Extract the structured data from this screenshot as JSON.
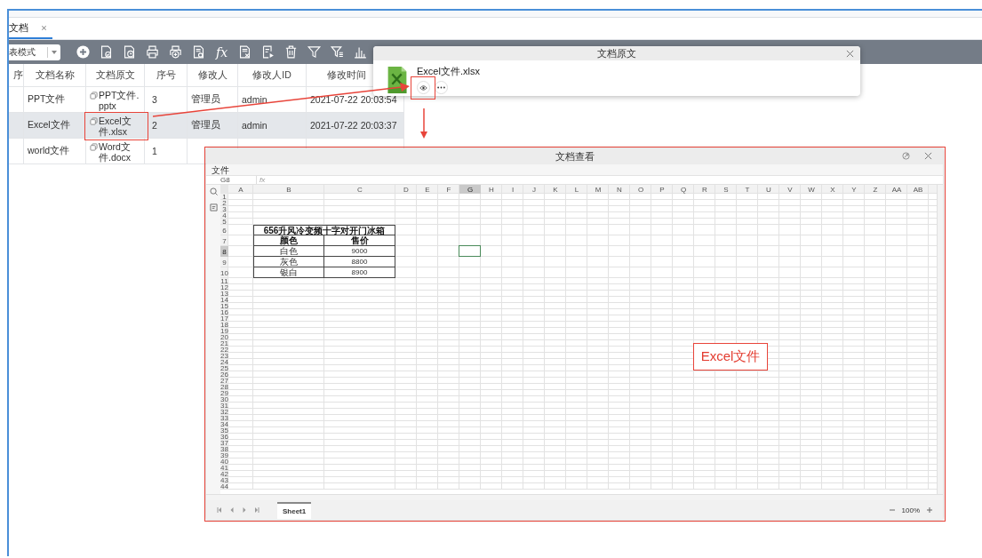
{
  "tabs": [
    {
      "label": "文档",
      "selected": true
    }
  ],
  "toolbar": {
    "view_mode": "表模式",
    "formula_label": "fx"
  },
  "table": {
    "columns": [
      "序",
      "文档名称",
      "文档原文",
      "序号",
      "修改人",
      "修改人ID",
      "修改时间"
    ],
    "rows": [
      {
        "name": "PPT文件",
        "file": "PPT文件.pptx",
        "seq": "3",
        "modifier": "管理员",
        "modifier_id": "admin",
        "modified": "2021-07-22 20:03:54",
        "selected": false
      },
      {
        "name": "Excel文件",
        "file": "Excel文件.xlsx",
        "seq": "2",
        "modifier": "管理员",
        "modifier_id": "admin",
        "modified": "2021-07-22 20:03:37",
        "selected": true
      },
      {
        "name": "world文件",
        "file": "Word文件.docx",
        "seq": "1",
        "selected": false
      }
    ]
  },
  "popup": {
    "title": "文档原文",
    "file_name": "Excel文件.xlsx"
  },
  "viewer": {
    "title": "文档查看",
    "menu": [
      "文件"
    ],
    "name_box": "G8",
    "formula_label": "fx",
    "columns": [
      {
        "label": "A",
        "selected": false
      },
      {
        "label": "B",
        "selected": false
      },
      {
        "label": "C",
        "selected": false
      },
      {
        "label": "D",
        "selected": false
      },
      {
        "label": "E",
        "selected": false
      },
      {
        "label": "F",
        "selected": false
      },
      {
        "label": "G",
        "selected": true
      },
      {
        "label": "H",
        "selected": false
      },
      {
        "label": "I",
        "selected": false
      },
      {
        "label": "J",
        "selected": false
      },
      {
        "label": "K",
        "selected": false
      },
      {
        "label": "L",
        "selected": false
      },
      {
        "label": "M",
        "selected": false
      },
      {
        "label": "N",
        "selected": false
      },
      {
        "label": "O",
        "selected": false
      },
      {
        "label": "P",
        "selected": false
      },
      {
        "label": "Q",
        "selected": false
      },
      {
        "label": "R",
        "selected": false
      },
      {
        "label": "S",
        "selected": false
      },
      {
        "label": "T",
        "selected": false
      },
      {
        "label": "U",
        "selected": false
      },
      {
        "label": "V",
        "selected": false
      },
      {
        "label": "W",
        "selected": false
      },
      {
        "label": "X",
        "selected": false
      },
      {
        "label": "Y",
        "selected": false
      },
      {
        "label": "Z",
        "selected": false
      },
      {
        "label": "AA",
        "selected": false
      },
      {
        "label": "AB",
        "selected": false
      }
    ],
    "rows": [
      {
        "label": "1",
        "selected": false
      },
      {
        "label": "2",
        "selected": false
      },
      {
        "label": "3",
        "selected": false
      },
      {
        "label": "4",
        "selected": false
      },
      {
        "label": "5",
        "selected": false
      },
      {
        "label": "6",
        "selected": false
      },
      {
        "label": "7",
        "selected": false
      },
      {
        "label": "8",
        "selected": true
      },
      {
        "label": "9",
        "selected": false
      },
      {
        "label": "10",
        "selected": false
      },
      {
        "label": "11",
        "selected": false
      },
      {
        "label": "12",
        "selected": false
      },
      {
        "label": "13",
        "selected": false
      },
      {
        "label": "14",
        "selected": false
      },
      {
        "label": "15",
        "selected": false
      },
      {
        "label": "16",
        "selected": false
      },
      {
        "label": "17",
        "selected": false
      },
      {
        "label": "18",
        "selected": false
      },
      {
        "label": "19",
        "selected": false
      },
      {
        "label": "20",
        "selected": false
      },
      {
        "label": "21",
        "selected": false
      },
      {
        "label": "22",
        "selected": false
      },
      {
        "label": "23",
        "selected": false
      },
      {
        "label": "24",
        "selected": false
      },
      {
        "label": "25",
        "selected": false
      },
      {
        "label": "26",
        "selected": false
      },
      {
        "label": "27",
        "selected": false
      },
      {
        "label": "28",
        "selected": false
      },
      {
        "label": "29",
        "selected": false
      },
      {
        "label": "30",
        "selected": false
      },
      {
        "label": "31",
        "selected": false
      },
      {
        "label": "32",
        "selected": false
      },
      {
        "label": "33",
        "selected": false
      },
      {
        "label": "34",
        "selected": false
      },
      {
        "label": "35",
        "selected": false
      },
      {
        "label": "36",
        "selected": false
      },
      {
        "label": "37",
        "selected": false
      },
      {
        "label": "38",
        "selected": false
      },
      {
        "label": "39",
        "selected": false
      },
      {
        "label": "40",
        "selected": false
      },
      {
        "label": "41",
        "selected": false
      },
      {
        "label": "42",
        "selected": false
      },
      {
        "label": "43",
        "selected": false
      },
      {
        "label": "44",
        "selected": false
      }
    ],
    "sheet_table": {
      "title": "656升风冷变频十字对开门冰箱",
      "header": [
        "颜色",
        "售价"
      ],
      "rows": [
        [
          "白色",
          "9000"
        ],
        [
          "灰色",
          "8800"
        ],
        [
          "银白",
          "8900"
        ]
      ]
    },
    "sheet_tabs": [
      {
        "label": "Sheet1",
        "selected": true
      }
    ],
    "zoom": "100%"
  },
  "annotation": {
    "label": "Excel文件"
  }
}
